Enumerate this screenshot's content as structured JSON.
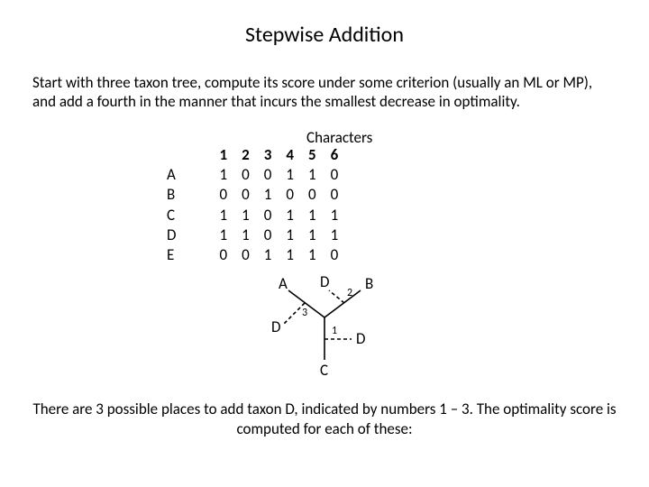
{
  "title": "Stepwise Addition",
  "intro": "Start with three taxon tree, compute its score under some criterion (usually an ML or MP), and add a fourth in the manner that incurs the smallest decrease in optimality.",
  "matrix": {
    "super_header": "Characters",
    "col_headers": [
      "1",
      "2",
      "3",
      "4",
      "5",
      "6"
    ],
    "rows": [
      {
        "label": "A",
        "vals": [
          "1",
          "0",
          "0",
          "1",
          "1",
          "0"
        ]
      },
      {
        "label": "B",
        "vals": [
          "0",
          "0",
          "1",
          "0",
          "0",
          "0"
        ]
      },
      {
        "label": "C",
        "vals": [
          "1",
          "1",
          "0",
          "1",
          "1",
          "1"
        ]
      },
      {
        "label": "D",
        "vals": [
          "1",
          "1",
          "0",
          "1",
          "1",
          "1"
        ]
      },
      {
        "label": "E",
        "vals": [
          "0",
          "0",
          "1",
          "1",
          "1",
          "0"
        ]
      }
    ]
  },
  "diagram": {
    "tips": {
      "A": "A",
      "B": "B",
      "C": "C"
    },
    "insert_label": "D",
    "positions": [
      "1",
      "2",
      "3"
    ]
  },
  "outro": "There are 3 possible places to add taxon D, indicated by numbers 1 – 3. The optimality score is computed for each of these:"
}
